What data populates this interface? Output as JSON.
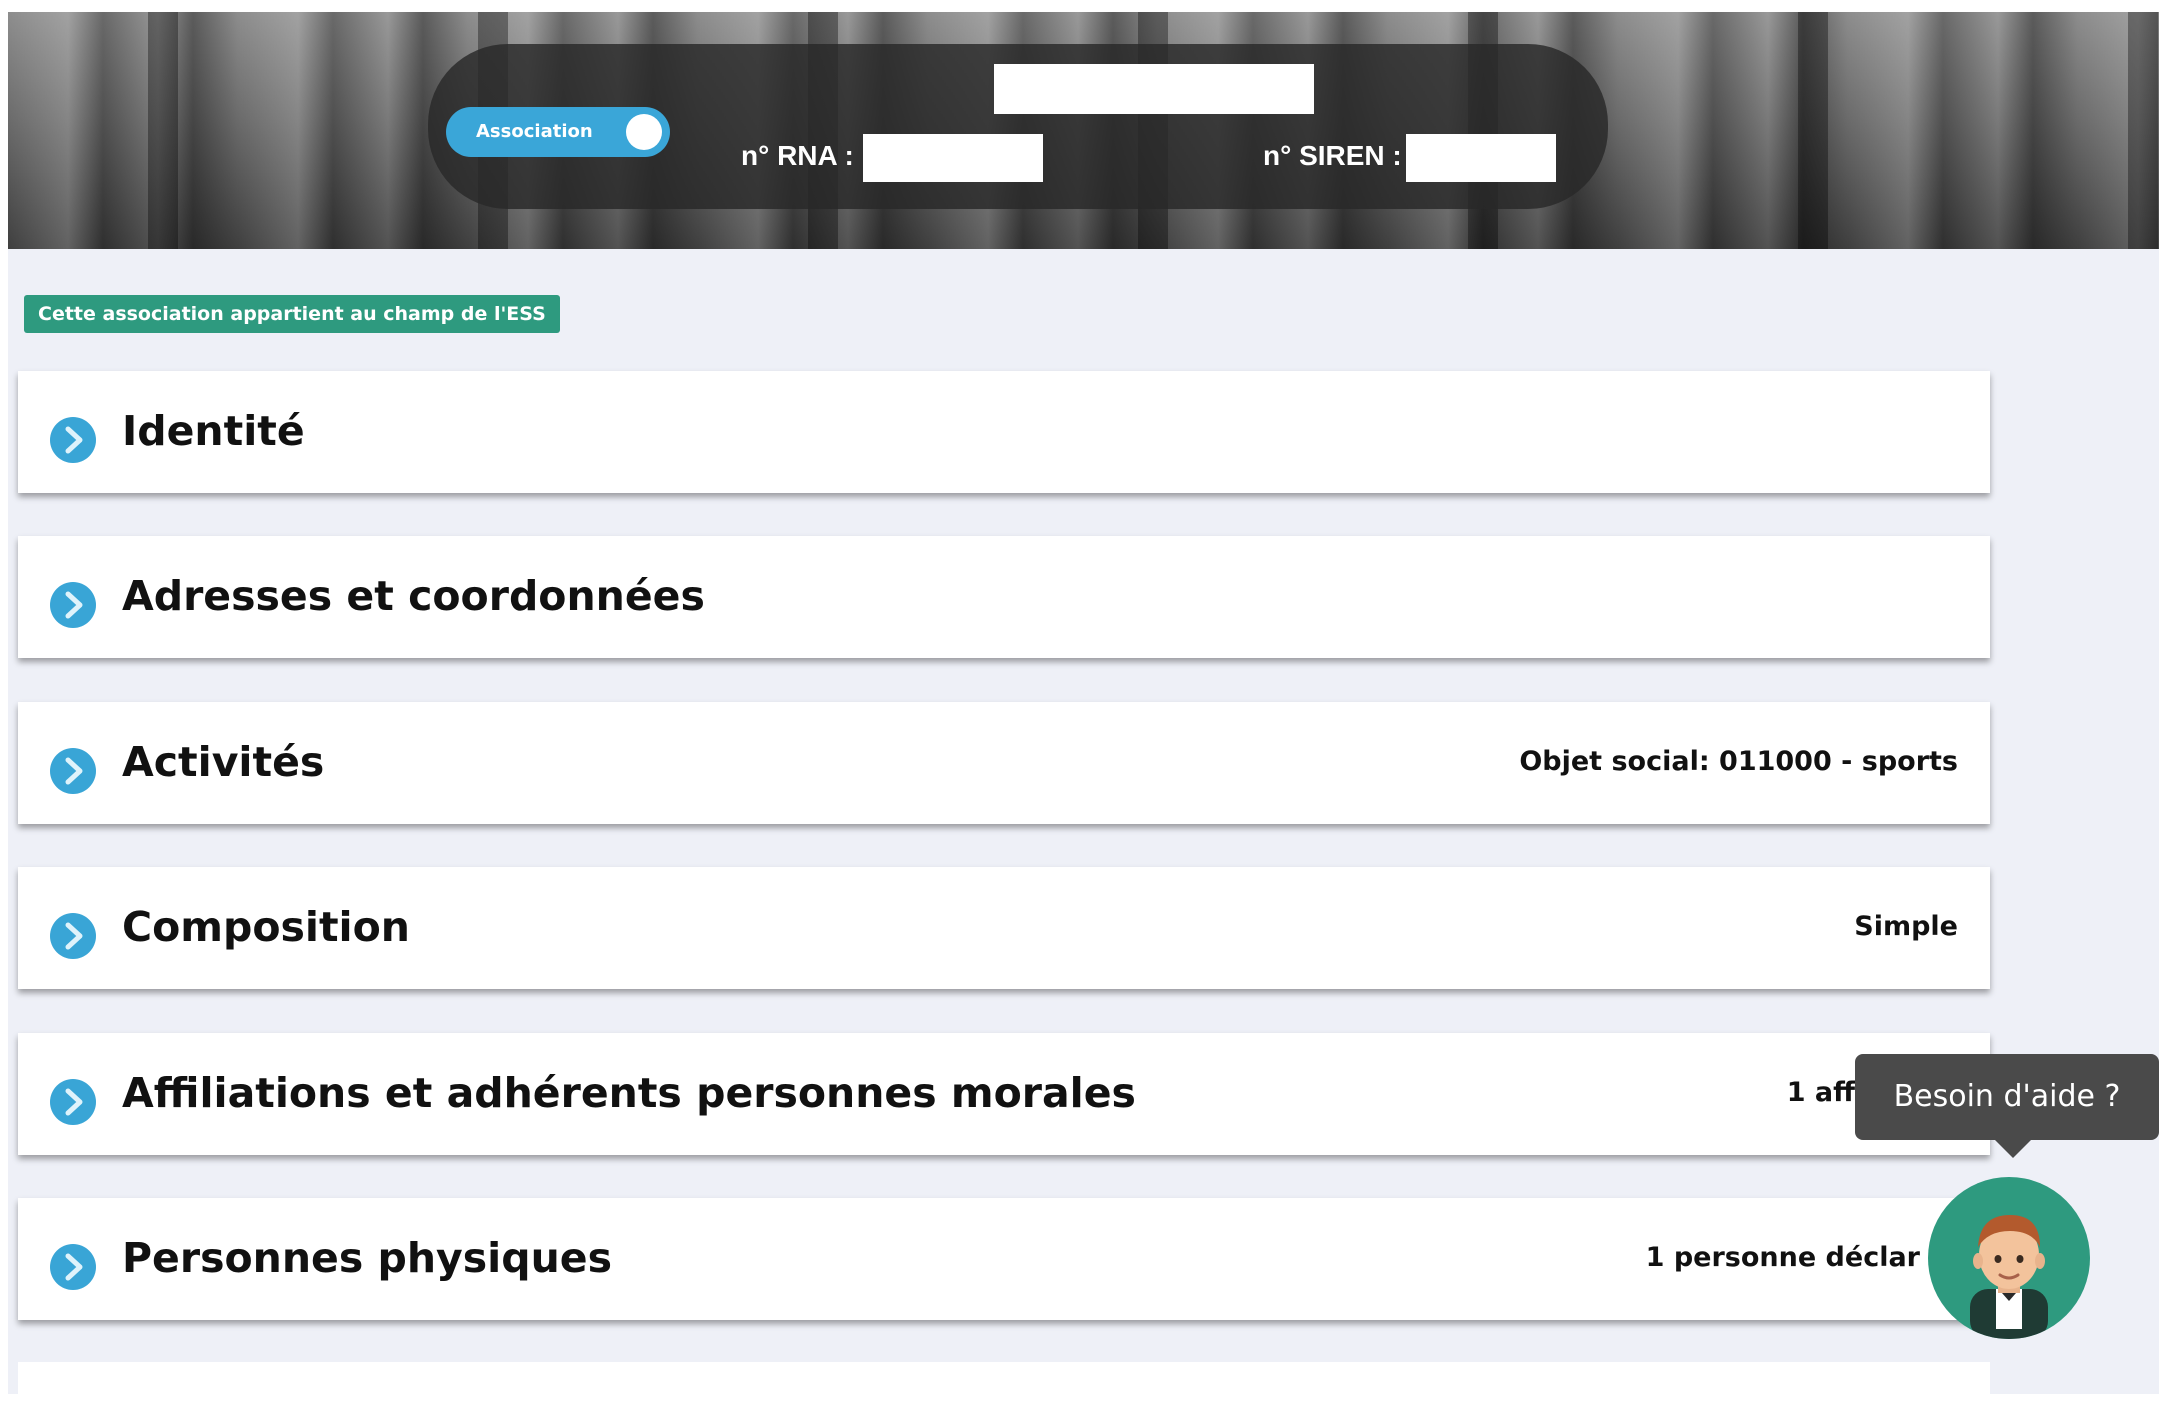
{
  "header": {
    "toggle_label": "Association",
    "rna_label": "n° RNA :",
    "siren_label": "n° SIREN :"
  },
  "ess_badge": "Cette association appartient au champ de l'ESS",
  "sections": [
    {
      "title": "Identité",
      "summary": ""
    },
    {
      "title": "Adresses et coordonnées",
      "summary": ""
    },
    {
      "title": "Activités",
      "summary": "Objet social: 011000 - sports"
    },
    {
      "title": "Composition",
      "summary": "Simple"
    },
    {
      "title": "Affiliations et adhérents personnes morales",
      "summary": "1 aff"
    },
    {
      "title": "Personnes physiques",
      "summary": "1 personne déclar"
    }
  ],
  "help": {
    "tooltip": "Besoin d'aide ?",
    "avatar_icon": "support-agent-icon"
  },
  "colors": {
    "accent": "#39a5d6",
    "ess_green": "#2e9a7f",
    "tooltip_bg": "#4a4a4a"
  }
}
